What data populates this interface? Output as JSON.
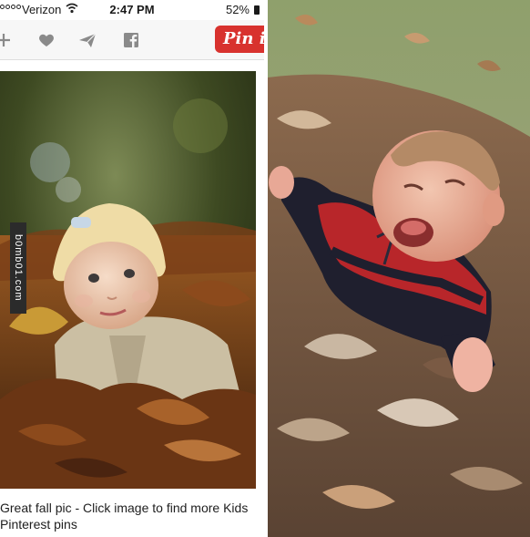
{
  "status_bar": {
    "carrier": "Verizon",
    "time": "2:47 PM",
    "battery": "52%"
  },
  "toolbar": {
    "icons": [
      "add-icon",
      "heart-icon",
      "send-icon",
      "facebook-icon"
    ],
    "pin_it_label": "Pin it"
  },
  "watermark": {
    "text": "b0mb01.com"
  },
  "caption": {
    "text": "Great fall pic - Click image to find more Kids Pinterest pins"
  },
  "colors": {
    "pin_it_red": "#d8322e",
    "toolbar_bg": "#f7f7f7"
  }
}
